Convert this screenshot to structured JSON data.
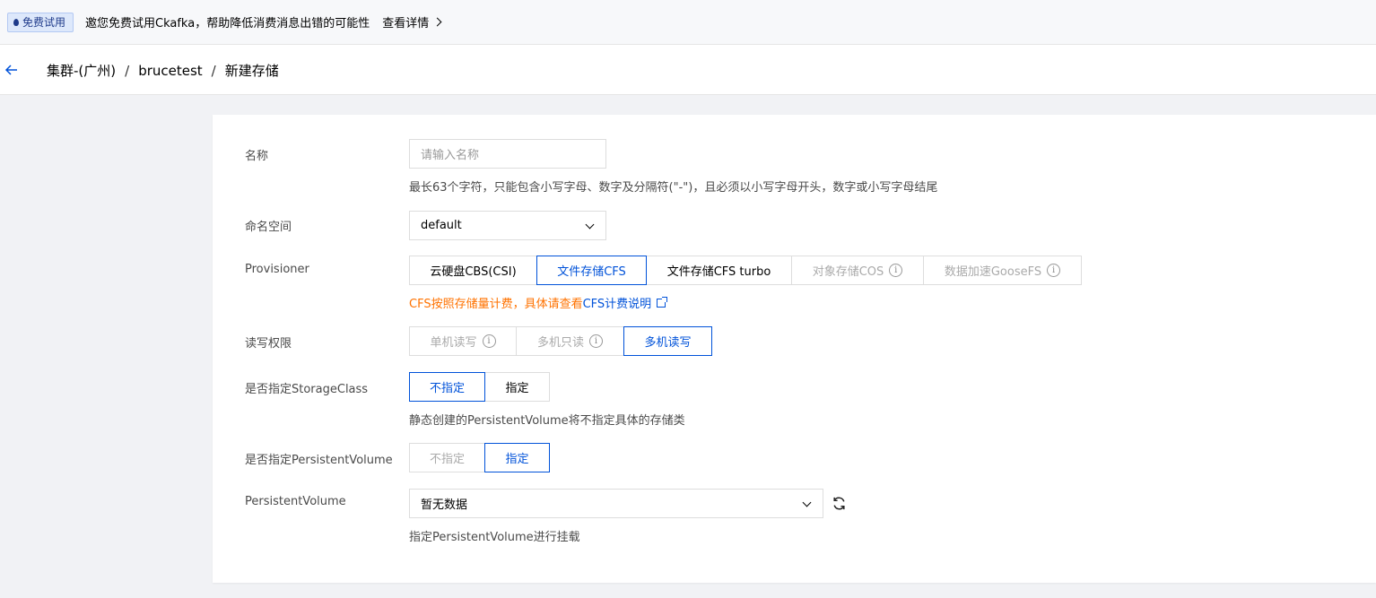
{
  "banner": {
    "badge": "免费试用",
    "text": "邀您免费试用Ckafka，帮助降低消费消息出错的可能性",
    "link": "查看详情"
  },
  "breadcrumb": {
    "cluster": "集群-(广州)",
    "separator": "/",
    "name": "brucetest",
    "page": "新建存储"
  },
  "form": {
    "name": {
      "label": "名称",
      "placeholder": "请输入名称",
      "hint": "最长63个字符，只能包含小写字母、数字及分隔符(\"-\")，且必须以小写字母开头，数字或小写字母结尾"
    },
    "namespace": {
      "label": "命名空间",
      "value": "default"
    },
    "provisioner": {
      "label": "Provisioner",
      "options": [
        "云硬盘CBS(CSI)",
        "文件存储CFS",
        "文件存储CFS turbo",
        "对象存储COS",
        "数据加速GooseFS"
      ],
      "selected": "文件存储CFS",
      "note": "CFS按照存储量计费，具体请查看",
      "note_link": "CFS计费说明"
    },
    "access": {
      "label": "读写权限",
      "options": [
        "单机读写",
        "多机只读",
        "多机读写"
      ],
      "selected": "多机读写"
    },
    "storage_class": {
      "label": "是否指定StorageClass",
      "options": [
        "不指定",
        "指定"
      ],
      "selected": "不指定",
      "hint": "静态创建的PersistentVolume将不指定具体的存储类"
    },
    "specify_pv": {
      "label": "是否指定PersistentVolume",
      "options": [
        "不指定",
        "指定"
      ],
      "selected": "指定"
    },
    "pv": {
      "label": "PersistentVolume",
      "value": "暂无数据",
      "hint": "指定PersistentVolume进行挂载"
    }
  },
  "colors": {
    "accent": "#0052d9",
    "warning": "#ff7200",
    "background": "#f1f2f5"
  }
}
